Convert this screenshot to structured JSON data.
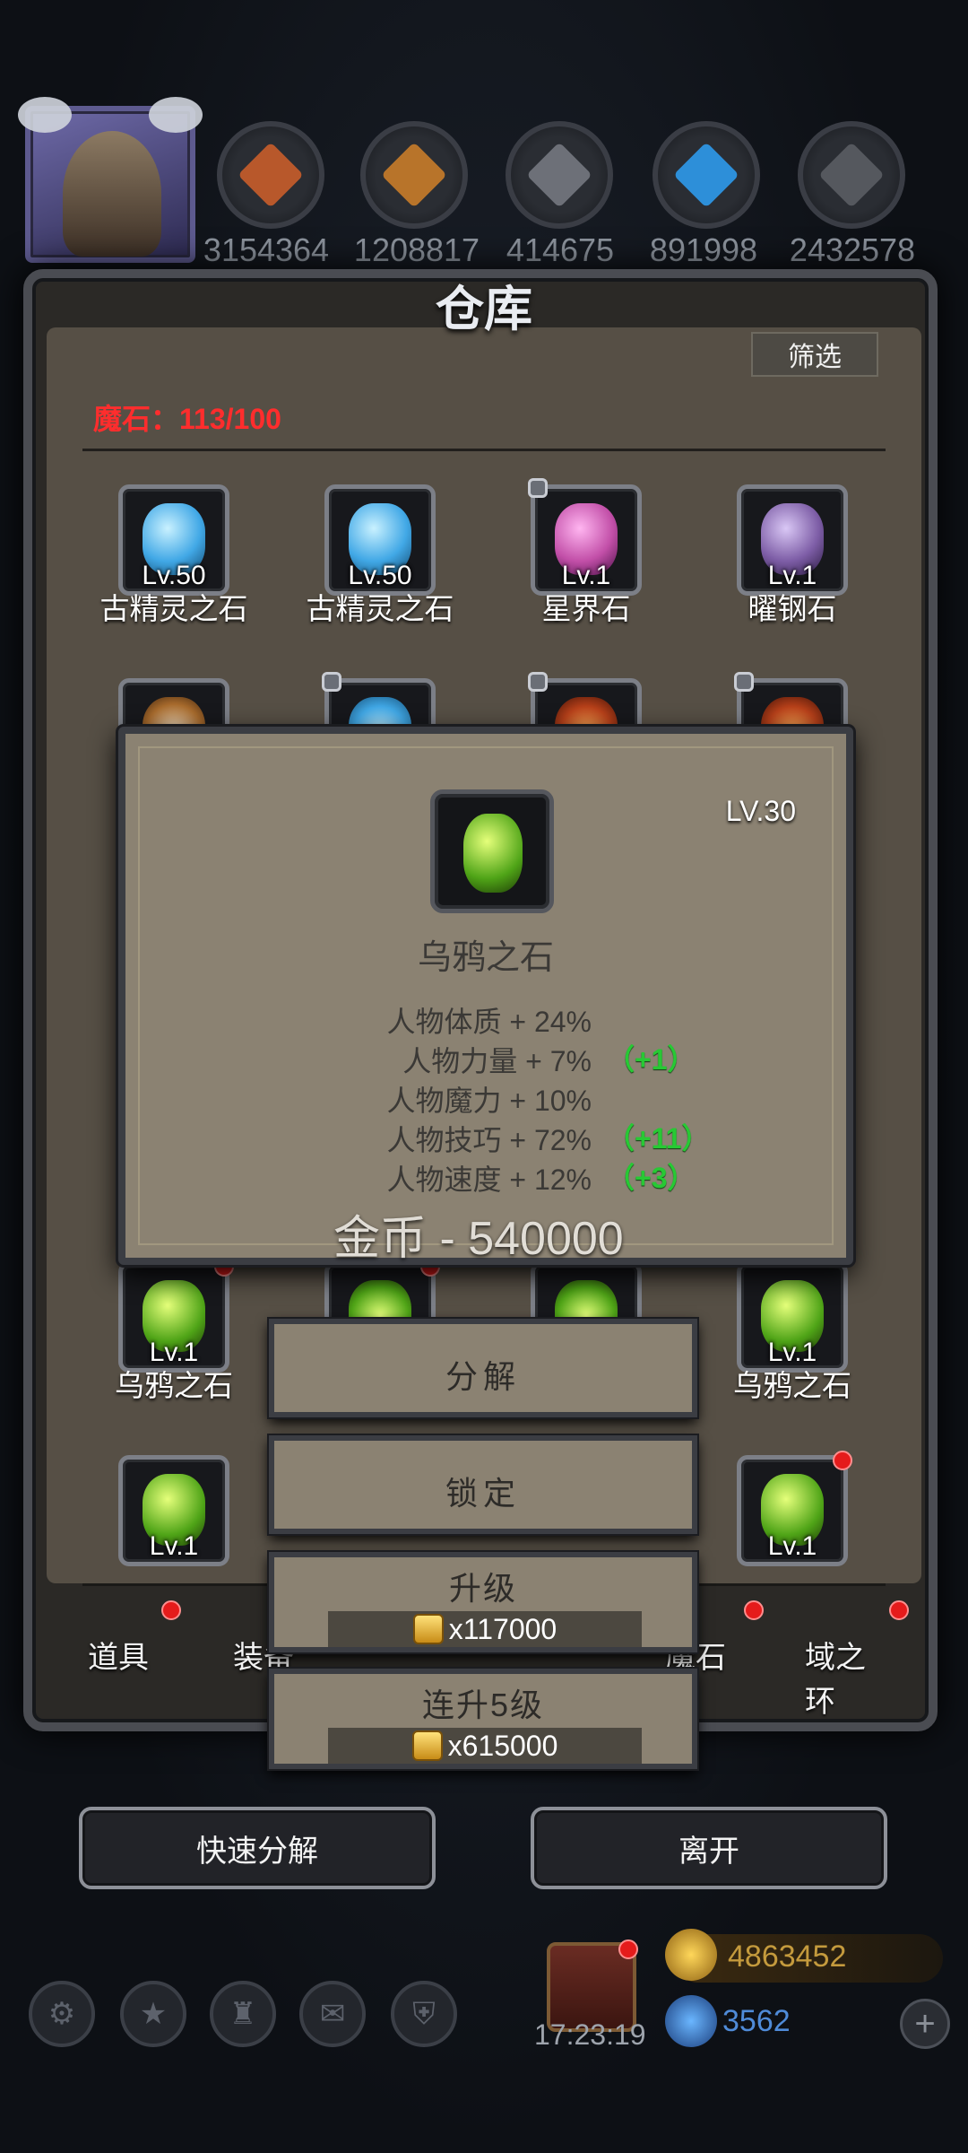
{
  "resources": [
    {
      "icon": "meat-resource-icon",
      "count": "3154364",
      "color": "#b8582b"
    },
    {
      "icon": "wood-resource-icon",
      "count": "1208817",
      "color": "#b8742a"
    },
    {
      "icon": "iron-resource-icon",
      "count": "414675",
      "color": "#6d7078"
    },
    {
      "icon": "crystal-resource-icon",
      "count": "891998",
      "color": "#2d8fd9"
    },
    {
      "icon": "steel-resource-icon",
      "count": "2432578",
      "color": "#55585e"
    }
  ],
  "panel": {
    "title": "仓库",
    "filter_label": "筛选",
    "magic_stone_count": "魔石：113/100"
  },
  "grid": {
    "row1": [
      {
        "lv": "Lv.50",
        "name": "古精灵之石",
        "locked": false,
        "color": "#41a8e6"
      },
      {
        "lv": "Lv.50",
        "name": "古精灵之石",
        "locked": false,
        "color": "#41a8e6"
      },
      {
        "lv": "Lv.1",
        "name": "星界石",
        "locked": true,
        "color": "#c24fa8"
      },
      {
        "lv": "Lv.1",
        "name": "曜钢石",
        "locked": false,
        "color": "#7d5da6"
      }
    ],
    "row4": [
      {
        "lv": "Lv.1",
        "name": "乌鸦之石"
      },
      {
        "lv": "Lv.1",
        "name": "乌鸦之石"
      }
    ],
    "row5": [
      {
        "lv": "Lv.1"
      },
      {
        "lv": "Lv.1"
      }
    ],
    "partial_right_label": "石"
  },
  "tabs": [
    "道具",
    "装备",
    "魔石",
    "域之环"
  ],
  "popup": {
    "level": "LV.30",
    "name": "乌鸦之石",
    "stats": [
      {
        "text": "人物体质 + 24%",
        "bonus": ""
      },
      {
        "text": "人物力量 + 7%",
        "bonus": "（+1）"
      },
      {
        "text": "人物魔力 + 10%",
        "bonus": ""
      },
      {
        "text": "人物技巧 + 72%",
        "bonus": "（+11）"
      },
      {
        "text": "人物速度 + 12%",
        "bonus": "（+3）"
      }
    ],
    "price": "金币 - 540000"
  },
  "actions": {
    "decompose": "分解",
    "lock": "锁定",
    "upgrade": "升级",
    "upgrade_cost": "x117000",
    "upgrade5": "连升5级",
    "upgrade5_cost": "x615000"
  },
  "buttons": {
    "quick_decompose": "快速分解",
    "leave": "离开"
  },
  "footer": {
    "timer": "17:23:19",
    "gold": "4863452",
    "gems": "3562"
  }
}
